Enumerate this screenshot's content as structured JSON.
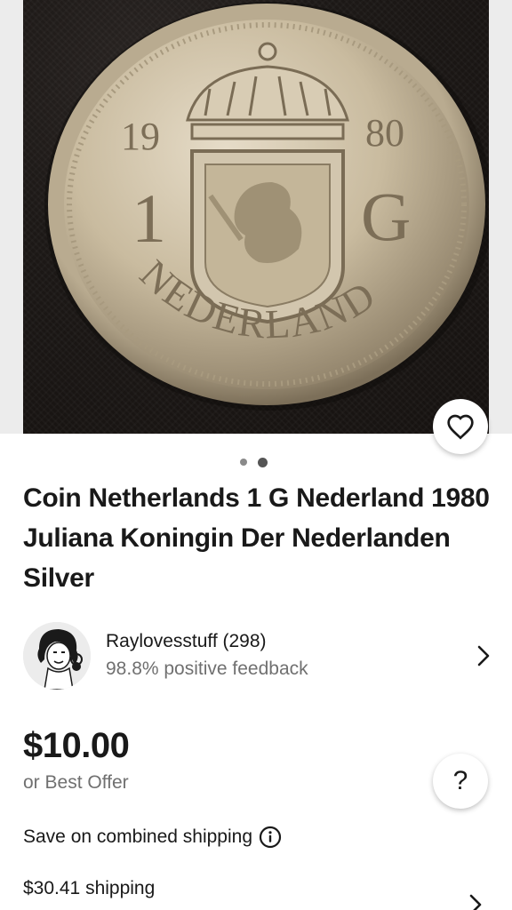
{
  "listing": {
    "title": "Coin Netherlands 1 G Nederland 1980 Juliana Koningin Der Nederlanden Silver",
    "images": {
      "count": 2,
      "active_index": 1
    },
    "coin_inscriptions": {
      "year_left": "19",
      "year_right": "80",
      "denomination_left": "1",
      "denomination_right": "G",
      "country": "NEDERLAND"
    }
  },
  "seller": {
    "name_with_count": "Raylovesstuff (298)",
    "feedback": "98.8% positive feedback"
  },
  "pricing": {
    "price": "$10.00",
    "offer_text": "or Best Offer",
    "help_label": "?"
  },
  "shipping": {
    "combined_text": "Save on combined shipping",
    "cost_text": "$30.41 shipping"
  },
  "icons": {
    "watch": "heart-icon",
    "info": "info-icon",
    "chevron": "chevron-right-icon"
  },
  "colors": {
    "text_primary": "#191919",
    "text_secondary": "#707070",
    "coin": "#cfc2a8"
  }
}
